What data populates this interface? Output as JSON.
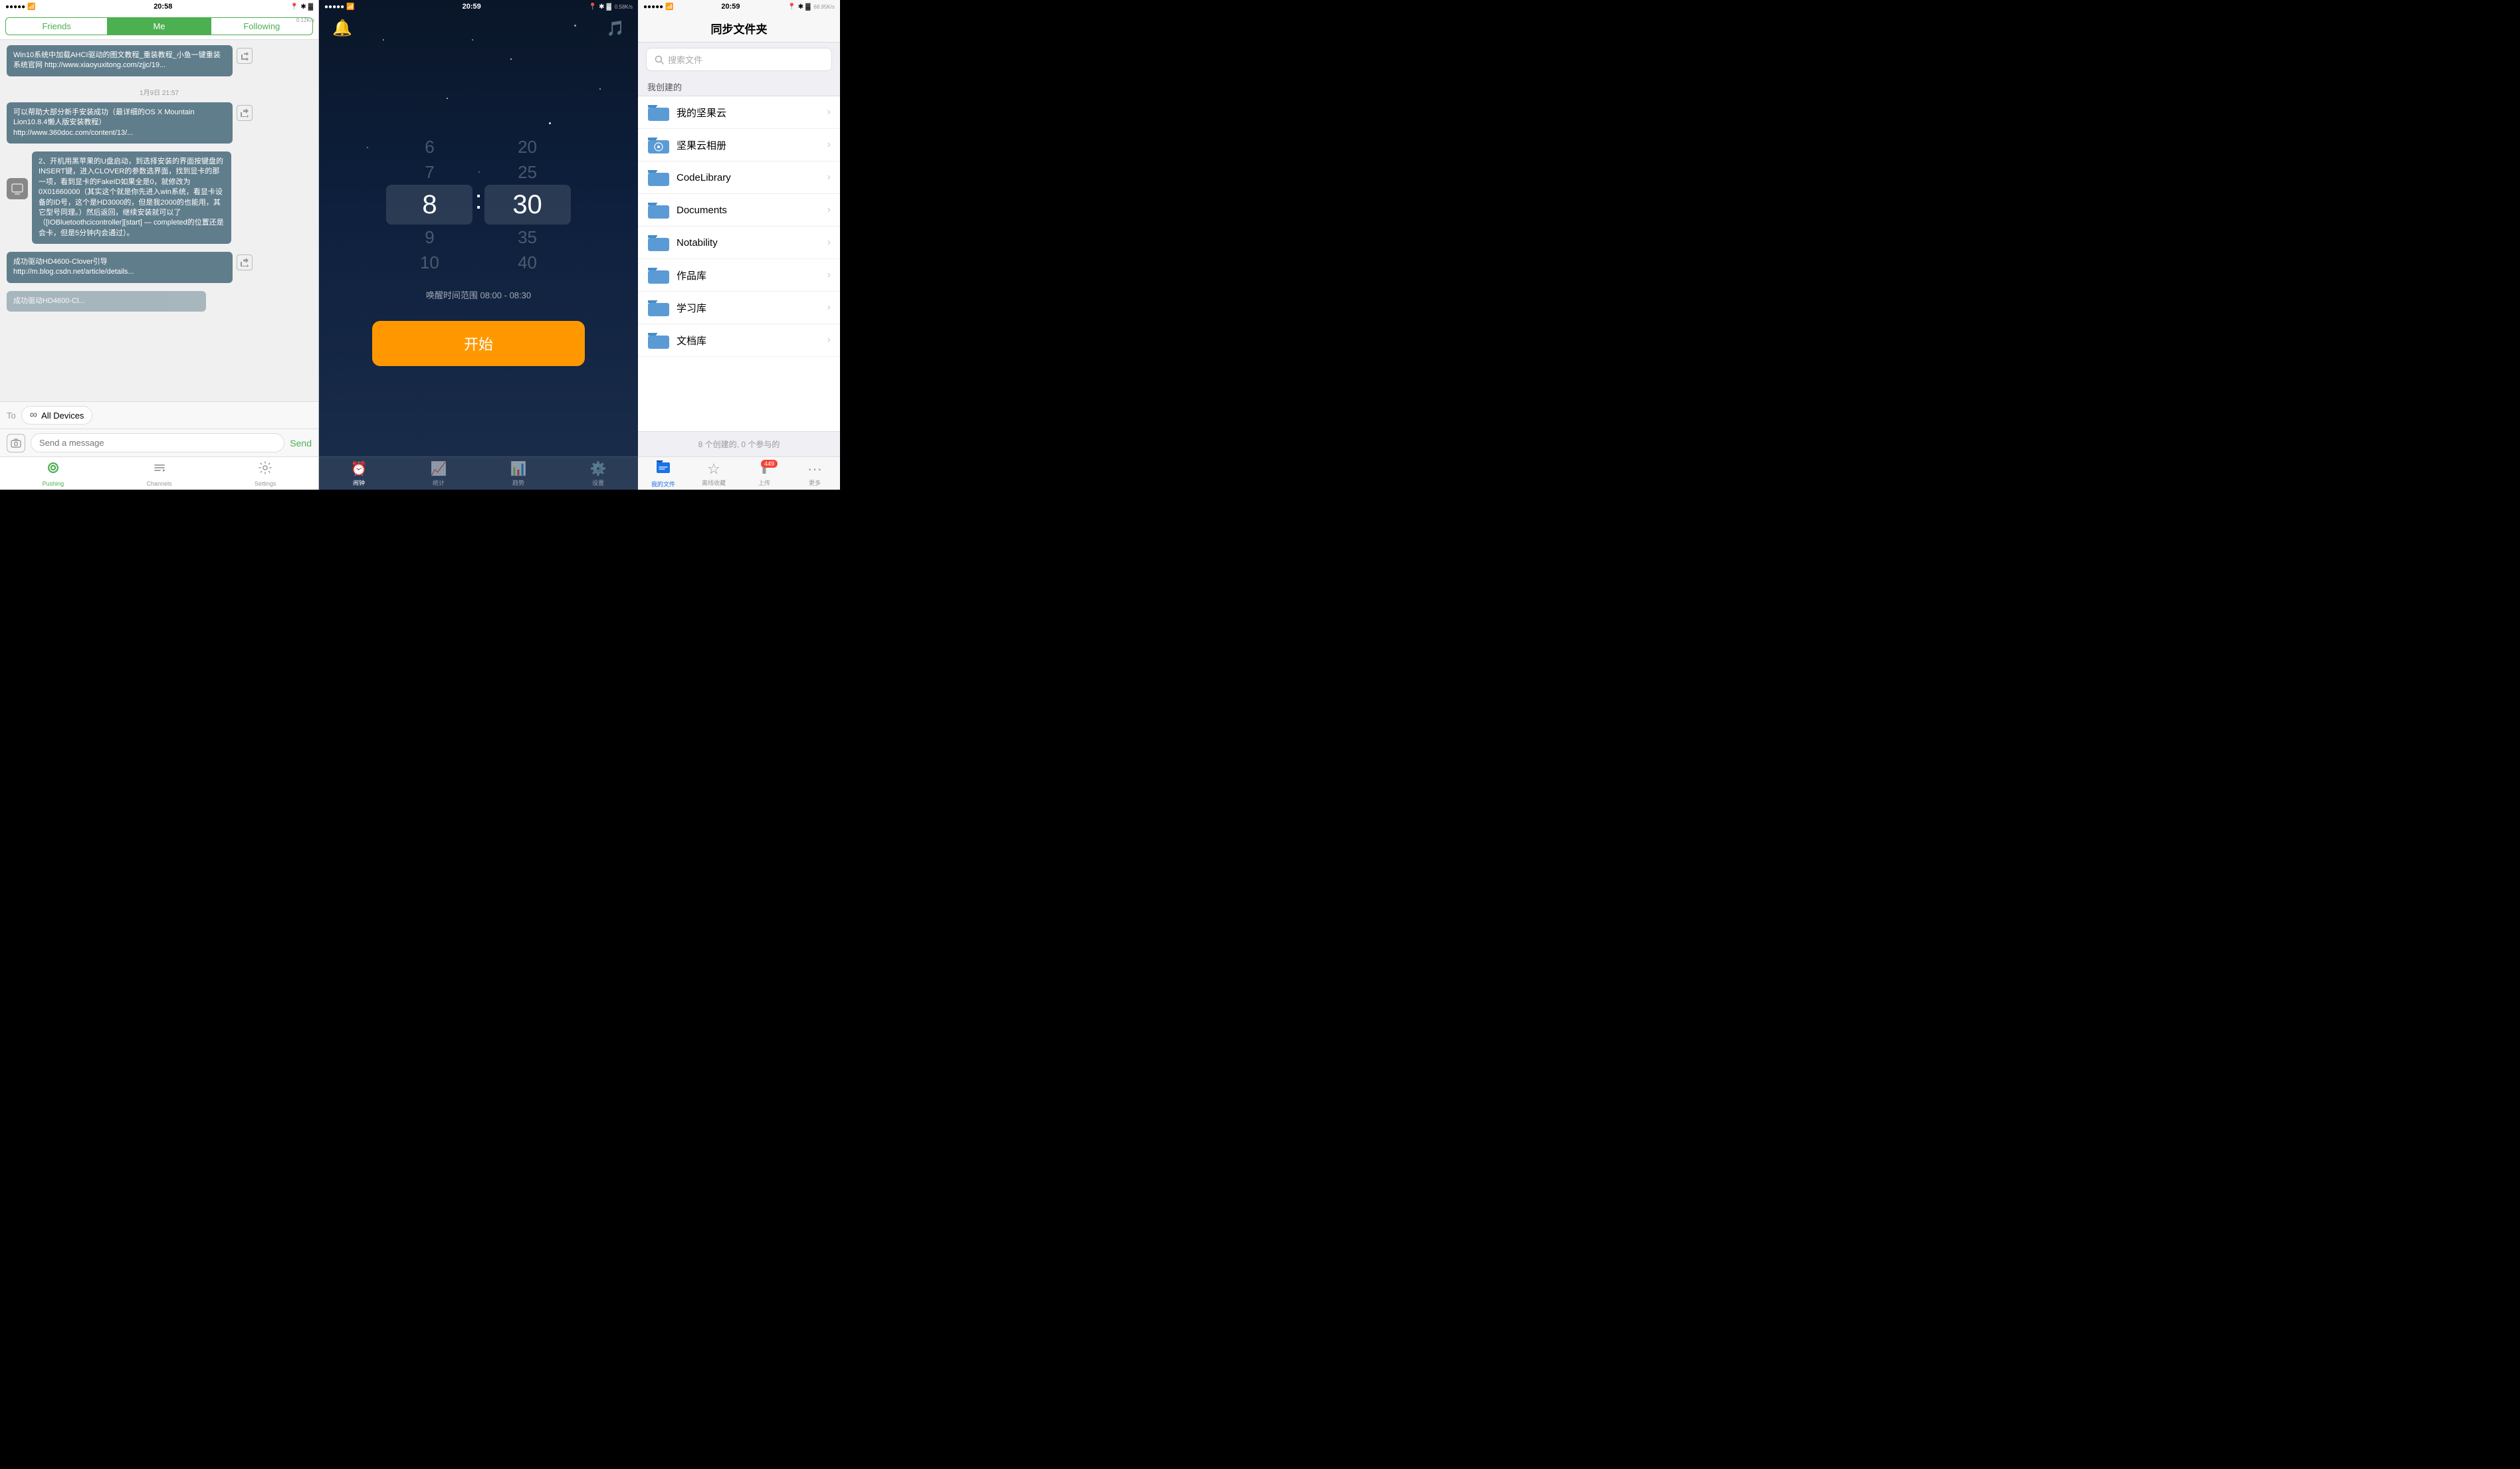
{
  "panel1": {
    "status": {
      "time": "20:58",
      "signal_dots": "●●●●●",
      "wifi": "wifi",
      "location": "📍",
      "bluetooth": "🔷",
      "battery": "🔋"
    },
    "speed_badge": "0.12K/s",
    "tabs": [
      {
        "label": "Friends",
        "active": false
      },
      {
        "label": "Me",
        "active": true
      },
      {
        "label": "Following",
        "active": false
      }
    ],
    "messages": [
      {
        "text": "Win10系统中加载AHCI驱动的图文教程_重装教程_小鱼一键重装系统官网\nhttp://www.xiaoyuxitong.com/zjjc/19...",
        "timestamp": null
      },
      {
        "timestamp": "1月9日 21:57",
        "text": null
      },
      {
        "text": "可以帮助大部分新手安装成功（最详细的OS X Mountain Lion10.8.4懒人版安装教程）\nhttp://www.360doc.com/content/13/...",
        "timestamp": null
      },
      {
        "text": "2、开机用黑苹果的U盘启动，到选择安装的界面按键盘的INSERT键，进入CLOVER的参数选界面，找到显卡的那一项，看到显卡的FakeID如果全是0，就修改为0X01660000（其实这个就是你先进入win系统，看显卡设备的ID号，这个是HD3000的，但是我2000的也能用，其它型号同理。）然后返回，继续安装就可以了（[IOBluetoothcicontroller][start] — completed的位置还是会卡，但是5分钟内会通过）。",
        "timestamp": null
      },
      {
        "text": "成功驱动HD4600-Clover引导\nhttp://m.blog.csdn.net/article/details...",
        "timestamp": null
      }
    ],
    "to_label": "To",
    "to_device": "All Devices",
    "input_placeholder": "Send a message",
    "send_label": "Send",
    "bottom_nav": [
      {
        "label": "Pushing",
        "active": true
      },
      {
        "label": "Channels",
        "active": false
      },
      {
        "label": "Settings",
        "active": false
      }
    ]
  },
  "panel2": {
    "status": {
      "time": "20:59",
      "speed_badge": "0.58K/s"
    },
    "time_picker": {
      "hours": [
        "6",
        "7",
        "8",
        "9",
        "10"
      ],
      "minutes": [
        "20",
        "25",
        "30",
        "35",
        "40"
      ],
      "selected_hour": "8",
      "selected_minute": "30",
      "colon": ":"
    },
    "wake_range": "唤醒时间范围 08:00 - 08:30",
    "start_button": "开始",
    "bottom_nav": [
      {
        "label": "闹钟",
        "active": true
      },
      {
        "label": "统计",
        "active": false
      },
      {
        "label": "趋势",
        "active": false
      },
      {
        "label": "设置",
        "active": false
      }
    ]
  },
  "panel3": {
    "status": {
      "time": "20:59",
      "speed_badge": "68.95K/s"
    },
    "title": "同步文件夹",
    "search_placeholder": "搜索文件",
    "section_header": "我创建的",
    "folders": [
      {
        "name": "我的坚果云"
      },
      {
        "name": "坚果云相册"
      },
      {
        "name": "CodeLibrary"
      },
      {
        "name": "Documents"
      },
      {
        "name": "Notability"
      },
      {
        "name": "作品库"
      },
      {
        "name": "学习库"
      },
      {
        "name": "文档库"
      }
    ],
    "footer": "8 个创建的, 0 个参与的",
    "bottom_nav": [
      {
        "label": "我的文件",
        "active": true,
        "badge": null
      },
      {
        "label": "离线收藏",
        "active": false,
        "badge": null
      },
      {
        "label": "上传",
        "active": false,
        "badge": "449"
      },
      {
        "label": "更多",
        "active": false,
        "badge": null
      }
    ]
  }
}
